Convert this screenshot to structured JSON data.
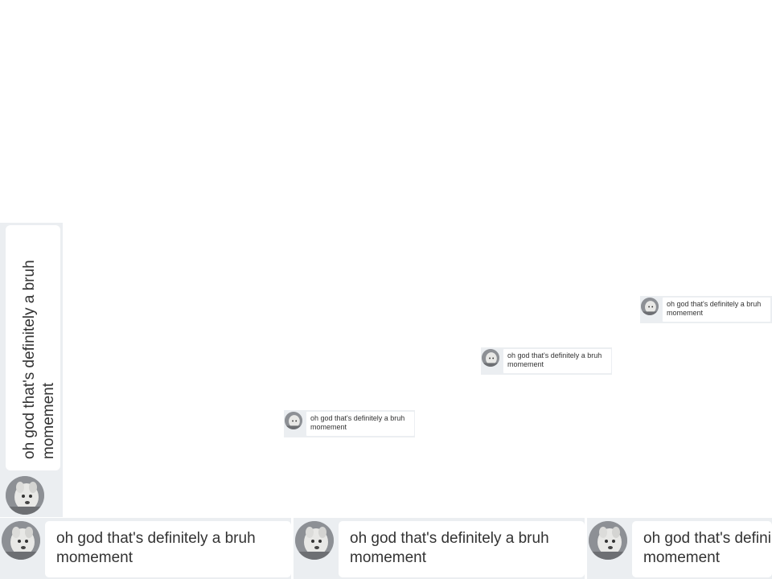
{
  "messages": [
    {
      "id": "vertical",
      "text": "oh god that's definitely a bruh momement",
      "avatar_icon": "dog-photo-icon"
    },
    {
      "id": "bottom-1",
      "text": "oh god that's definitely a bruh momement",
      "avatar_icon": "dog-photo-icon"
    },
    {
      "id": "bottom-2",
      "text": "oh god that's definitely a bruh momement",
      "avatar_icon": "dog-photo-icon"
    },
    {
      "id": "bottom-3",
      "text": "oh god that's defini momement",
      "avatar_icon": "dog-photo-icon"
    },
    {
      "id": "small-1",
      "text": "oh god that's definitely a bruh momement",
      "avatar_icon": "dog-photo-icon"
    },
    {
      "id": "small-2",
      "text": "oh god that's definitely a bruh momement",
      "avatar_icon": "dog-photo-icon"
    },
    {
      "id": "small-3",
      "text": "oh god that's definitely a bruh momement",
      "avatar_icon": "dog-photo-icon"
    }
  ],
  "colors": {
    "strip_background": "#ebeef1",
    "bubble_background": "#ffffff",
    "text": "#333333"
  }
}
